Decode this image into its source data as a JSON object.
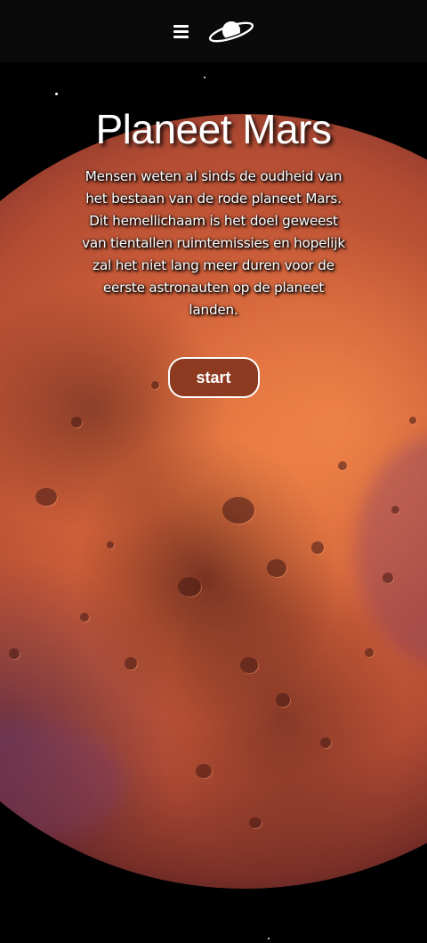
{
  "header": {
    "menu_icon": "hamburger-menu-icon",
    "logo_icon": "planet-saturn-icon"
  },
  "hero": {
    "title": "Planeet Mars",
    "description": "Mensen weten al sinds de oudheid van het bestaan van de rode planeet Mars. Dit hemellichaam is het doel geweest van tientallen ruimtemissies en hopelijk zal het niet lang meer duren voor de eerste astronauten op de planeet landen.",
    "start_label": "start"
  },
  "colors": {
    "header_bg": "#0a0a0a",
    "page_bg": "#000000",
    "button_bg": "#8d3a20",
    "text": "#ffffff",
    "planet": "#d0603a"
  }
}
